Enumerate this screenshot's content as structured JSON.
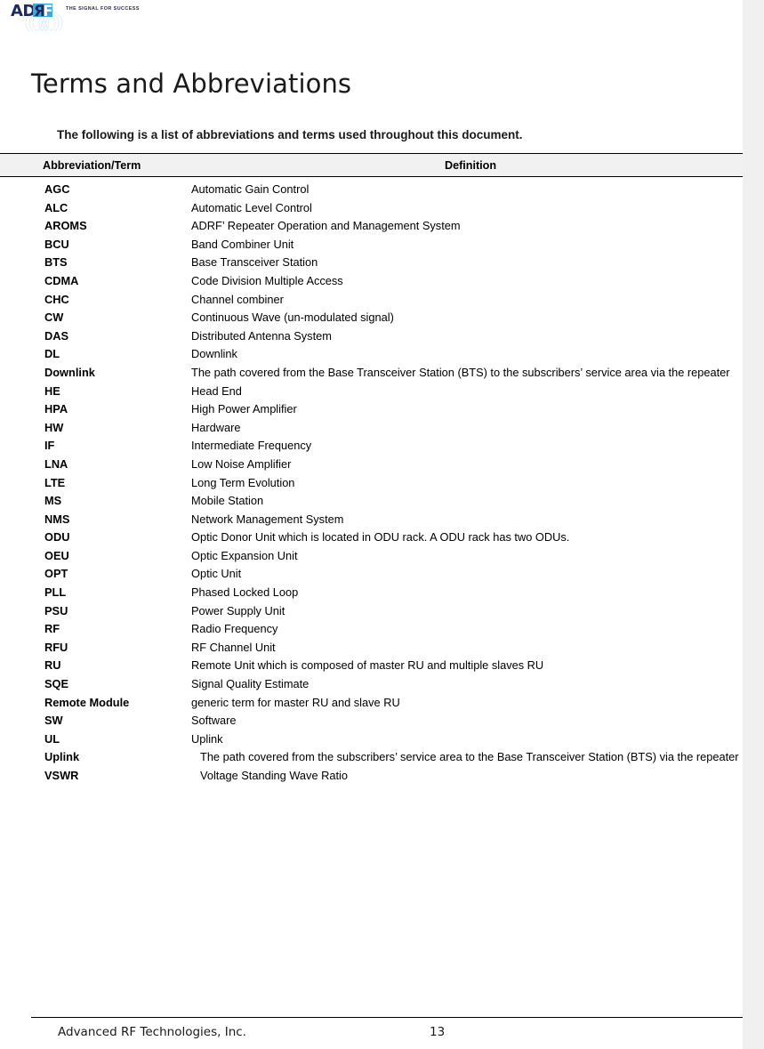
{
  "header": {
    "logo_text_dark": "AD",
    "logo_text_light": "RF",
    "logo_tagline": "THE SIGNAL FOR SUCCESS",
    "brand_dark_color": "#1b2a5e",
    "brand_light_color": "#3aa9e0"
  },
  "page_title": "Terms and Abbreviations",
  "intro": "The following is a list of abbreviations and terms used throughout this document.",
  "table": {
    "columns": {
      "term": "Abbreviation/Term",
      "definition": "Definition"
    },
    "rows": [
      {
        "term": "AGC",
        "definition": "Automatic Gain Control"
      },
      {
        "term": "ALC",
        "definition": "Automatic Level Control"
      },
      {
        "term": "AROMS",
        "definition": "ADRF’ Repeater Operation and Management System"
      },
      {
        "term": "BCU",
        "definition": "Band Combiner Unit"
      },
      {
        "term": "BTS",
        "definition": "Base Transceiver Station"
      },
      {
        "term": "CDMA",
        "definition": "Code Division Multiple Access"
      },
      {
        "term": "CHC",
        "definition": "Channel combiner"
      },
      {
        "term": "CW",
        "definition": "Continuous Wave (un-modulated signal)"
      },
      {
        "term": "DAS",
        "definition": "Distributed Antenna System"
      },
      {
        "term": "DL",
        "definition": "Downlink"
      },
      {
        "term": "Downlink",
        "definition": "The path covered from the Base Transceiver Station (BTS) to the subscribers’ service area via the repeater"
      },
      {
        "term": "HE",
        "definition": "Head End"
      },
      {
        "term": "HPA",
        "definition": "High Power Amplifier"
      },
      {
        "term": "HW",
        "definition": "Hardware"
      },
      {
        "term": "IF",
        "definition": "Intermediate Frequency"
      },
      {
        "term": "LNA",
        "definition": "Low Noise Amplifier"
      },
      {
        "term": "LTE",
        "definition": "Long Term Evolution"
      },
      {
        "term": "MS",
        "definition": "Mobile Station"
      },
      {
        "term": "NMS",
        "definition": "Network Management System"
      },
      {
        "term": "ODU",
        "definition": "Optic Donor Unit which is located in ODU rack. A ODU rack has two ODUs."
      },
      {
        "term": "OEU",
        "definition": "Optic Expansion Unit"
      },
      {
        "term": "OPT",
        "definition": "Optic Unit"
      },
      {
        "term": "PLL",
        "definition": "Phased Locked Loop"
      },
      {
        "term": "PSU",
        "definition": "Power Supply Unit"
      },
      {
        "term": "RF",
        "definition": "Radio Frequency"
      },
      {
        "term": "RFU",
        "definition": "RF Channel Unit"
      },
      {
        "term": "RU",
        "definition": "Remote Unit which is composed of master RU and multiple slaves RU"
      },
      {
        "term": "SQE",
        "definition": "Signal Quality Estimate"
      },
      {
        "term": "Remote Module",
        "definition": "generic term for master RU and slave RU"
      },
      {
        "term": "SW",
        "definition": "Software"
      },
      {
        "term": "UL",
        "definition": "Uplink"
      },
      {
        "term": "Uplink",
        "definition": "The path covered from the subscribers’ service area to the Base Transceiver Station (BTS) via the repeater"
      },
      {
        "term": "VSWR",
        "definition": "Voltage Standing Wave Ratio"
      }
    ]
  },
  "footer": {
    "company": "Advanced RF Technologies, Inc.",
    "page_number": "13"
  }
}
